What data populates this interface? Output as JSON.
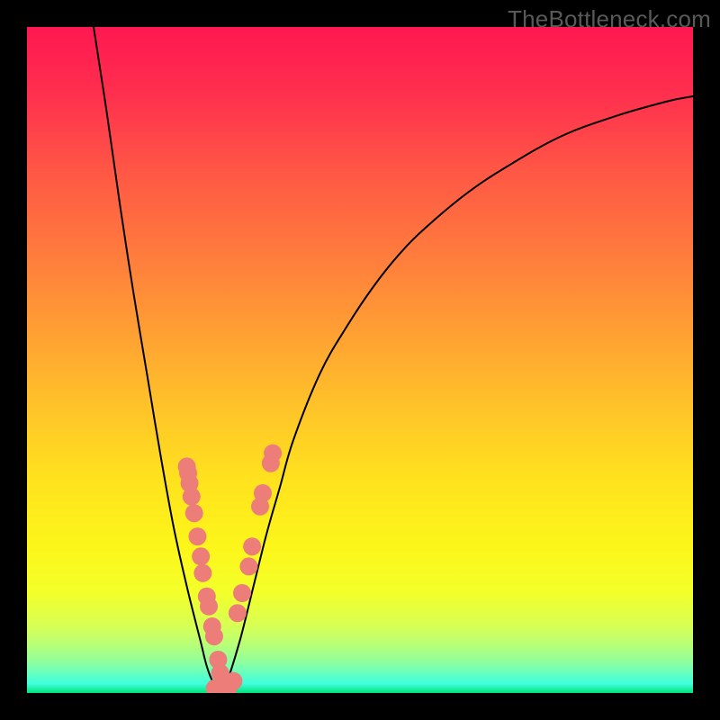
{
  "watermark": "TheBottleneck.com",
  "chart_data": {
    "type": "line",
    "title": "",
    "xlabel": "",
    "ylabel": "",
    "xlim": [
      0,
      100
    ],
    "ylim": [
      0,
      100
    ],
    "grid": false,
    "legend": false,
    "series": [
      {
        "name": "curve-left",
        "x": [
          10,
          12,
          14,
          16,
          18,
          20,
          22,
          24,
          26,
          27,
          28,
          29,
          29.3
        ],
        "values": [
          100,
          87,
          73,
          60,
          48,
          36,
          25,
          16,
          8,
          4,
          1.5,
          0.5,
          0
        ],
        "stroke": "#000000",
        "width": 2
      },
      {
        "name": "curve-right",
        "x": [
          29.3,
          30,
          32,
          34,
          36,
          38,
          40,
          44,
          48,
          52,
          56,
          60,
          66,
          72,
          80,
          88,
          96,
          100
        ],
        "values": [
          0,
          1.5,
          8,
          16,
          24,
          31,
          38,
          48,
          55,
          61,
          66,
          70,
          75,
          79,
          83.5,
          86.5,
          88.8,
          89.6
        ],
        "stroke": "#000000",
        "width": 2
      }
    ],
    "markers_left": [
      {
        "x": 24.0,
        "y": 34.0
      },
      {
        "x": 24.2,
        "y": 33.0
      },
      {
        "x": 24.4,
        "y": 31.5
      },
      {
        "x": 24.7,
        "y": 29.5
      },
      {
        "x": 25.1,
        "y": 27.0
      },
      {
        "x": 25.6,
        "y": 23.5
      },
      {
        "x": 26.1,
        "y": 20.5
      },
      {
        "x": 26.4,
        "y": 18.0
      },
      {
        "x": 27.0,
        "y": 14.5
      },
      {
        "x": 27.3,
        "y": 13.0
      },
      {
        "x": 27.8,
        "y": 10.0
      },
      {
        "x": 28.1,
        "y": 8.5
      },
      {
        "x": 28.7,
        "y": 5.0
      },
      {
        "x": 29.0,
        "y": 3.0
      }
    ],
    "markers_right": [
      {
        "x": 33.3,
        "y": 19.0
      },
      {
        "x": 33.8,
        "y": 22.0
      },
      {
        "x": 35.0,
        "y": 28.0
      },
      {
        "x": 35.4,
        "y": 30.0
      },
      {
        "x": 36.6,
        "y": 34.5
      },
      {
        "x": 36.9,
        "y": 36.0
      },
      {
        "x": 31.6,
        "y": 12.0
      },
      {
        "x": 32.3,
        "y": 15.0
      }
    ],
    "markers_bottom": [
      {
        "x": 28.2,
        "y": 0.7
      },
      {
        "x": 29.3,
        "y": 0.4
      },
      {
        "x": 30.2,
        "y": 0.7
      },
      {
        "x": 31.0,
        "y": 1.8
      }
    ],
    "marker_style": {
      "fill": "#ec7d79",
      "r": 10
    }
  }
}
